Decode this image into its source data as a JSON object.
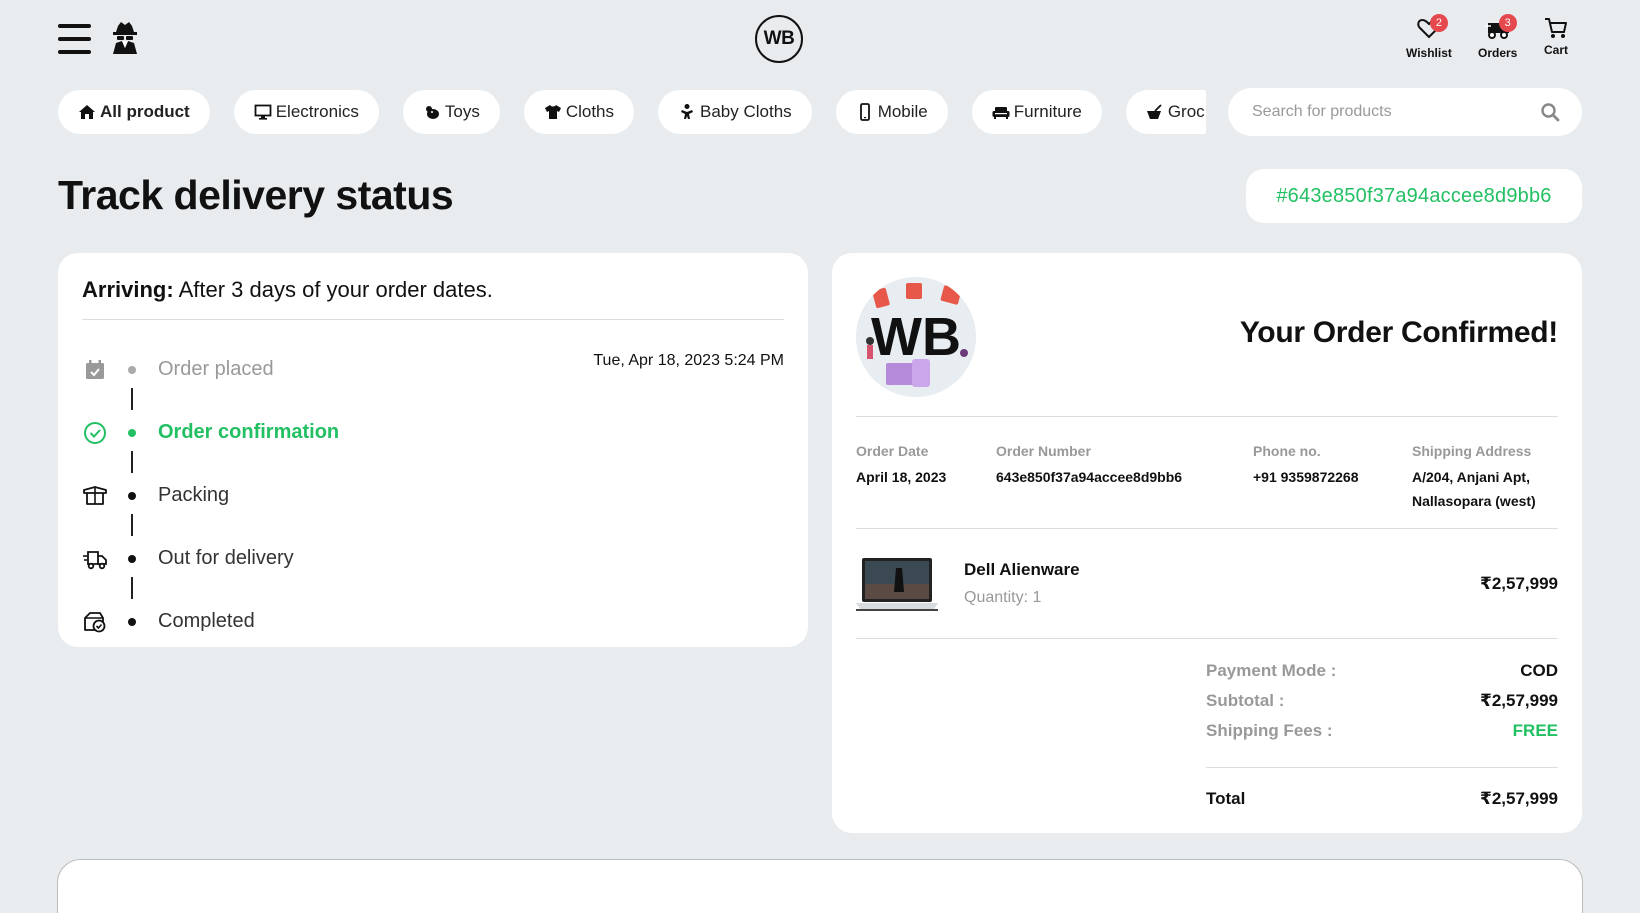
{
  "header": {
    "logo_text": "WB",
    "wishlist_label": "Wishlist",
    "wishlist_count": "2",
    "orders_label": "Orders",
    "orders_count": "3",
    "cart_label": "Cart",
    "icons": [
      "menu-icon",
      "spy-icon",
      "heart-icon",
      "delivery-truck-icon",
      "cart-icon"
    ]
  },
  "categories": [
    {
      "label": "All product",
      "icon": "home-icon"
    },
    {
      "label": "Electronics",
      "icon": "monitor-icon"
    },
    {
      "label": "Toys",
      "icon": "toy-icon"
    },
    {
      "label": "Cloths",
      "icon": "tshirt-icon"
    },
    {
      "label": "Baby Cloths",
      "icon": "baby-icon"
    },
    {
      "label": "Mobile",
      "icon": "mobile-icon"
    },
    {
      "label": "Furniture",
      "icon": "couch-icon"
    },
    {
      "label": "Groc",
      "icon": "grocery-icon"
    }
  ],
  "search": {
    "placeholder": "Search for products"
  },
  "page": {
    "title": "Track delivery status",
    "order_id": "#643e850f37a94accee8d9bb6"
  },
  "tracking": {
    "arriving_label": "Arriving:",
    "arriving_text": "After 3 days of your order dates.",
    "steps": [
      {
        "label": "Order placed",
        "time": "Tue, Apr 18, 2023 5:24 PM",
        "state": "done",
        "icon": "calendar-check-icon"
      },
      {
        "label": "Order confirmation",
        "time": "",
        "state": "active",
        "icon": "check-circle-icon"
      },
      {
        "label": "Packing",
        "time": "",
        "state": "pending",
        "icon": "box-icon"
      },
      {
        "label": "Out for delivery",
        "time": "",
        "state": "pending",
        "icon": "truck-fast-icon"
      },
      {
        "label": "Completed",
        "time": "",
        "state": "pending",
        "icon": "box-check-icon"
      }
    ]
  },
  "confirmation": {
    "logo_text": "WB",
    "title": "Your Order Confirmed!",
    "info": {
      "order_date_label": "Order Date",
      "order_date": "April 18, 2023",
      "order_number_label": "Order Number",
      "order_number": "643e850f37a94accee8d9bb6",
      "phone_label": "Phone no.",
      "phone": "+91 9359872268",
      "address_label": "Shipping Address",
      "address_line1": "A/204, Anjani Apt,",
      "address_line2": "Nallasopara (west)"
    },
    "product": {
      "name": "Dell Alienware",
      "quantity": "Quantity: 1",
      "price": "₹2,57,999"
    },
    "summary": {
      "payment_mode_label": "Payment Mode :",
      "payment_mode": "COD",
      "subtotal_label": "Subtotal :",
      "subtotal": "₹2,57,999",
      "shipping_label": "Shipping Fees :",
      "shipping": "FREE",
      "total_label": "Total",
      "total": "₹2,57,999"
    }
  },
  "colors": {
    "accent_green": "#22c063",
    "badge_red": "#e5484d",
    "background": "#e8ecef"
  }
}
